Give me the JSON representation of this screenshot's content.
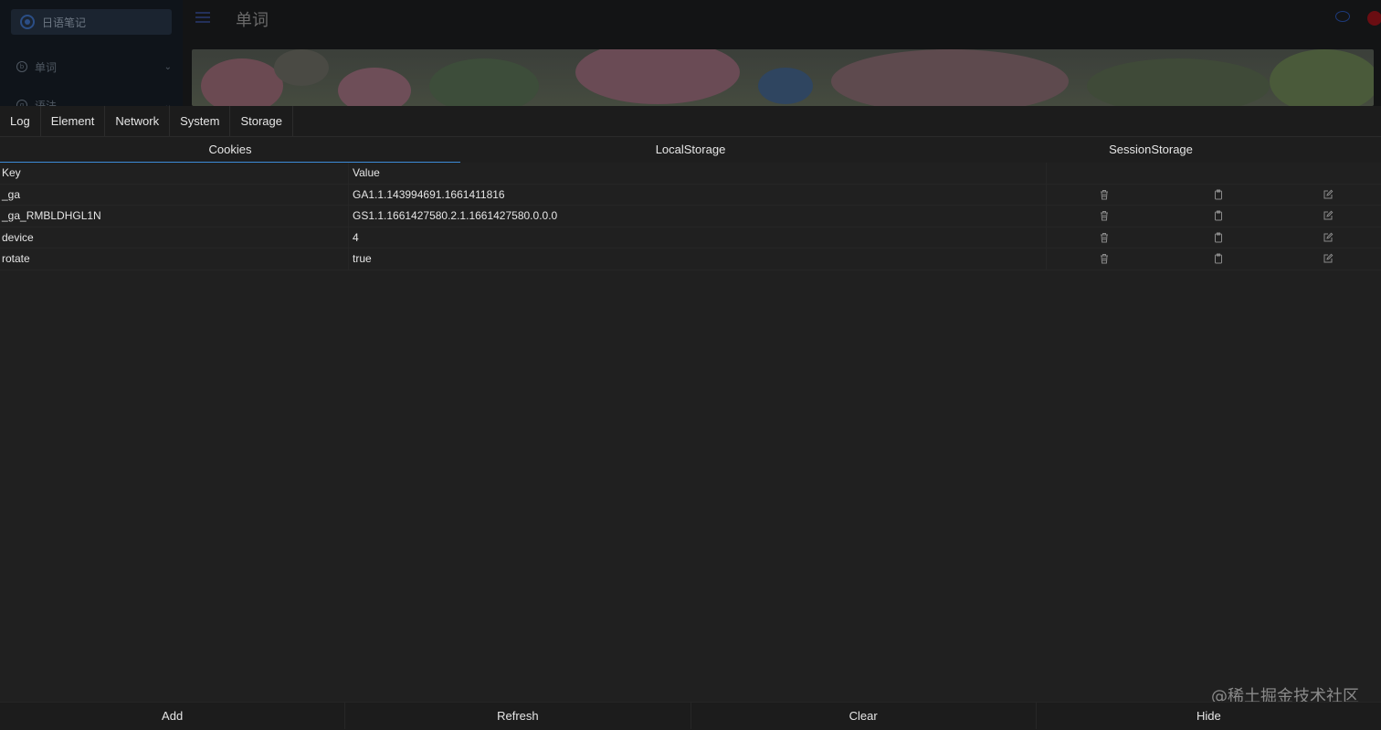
{
  "app": {
    "search_placeholder": "日语笔记",
    "nav": [
      {
        "label": "单词"
      },
      {
        "label": "语法"
      }
    ],
    "page_title": "单词"
  },
  "console": {
    "tabs": [
      {
        "label": "Log"
      },
      {
        "label": "Element"
      },
      {
        "label": "Network"
      },
      {
        "label": "System"
      },
      {
        "label": "Storage"
      }
    ],
    "storage_tabs": [
      {
        "label": "Cookies",
        "active": true
      },
      {
        "label": "LocalStorage",
        "active": false
      },
      {
        "label": "SessionStorage",
        "active": false
      }
    ],
    "columns": {
      "key": "Key",
      "value": "Value"
    },
    "rows": [
      {
        "key": "_ga",
        "value": "GA1.1.143994691.1661411816"
      },
      {
        "key": "_ga_RMBLDHGL1N",
        "value": "GS1.1.1661427580.2.1.1661427580.0.0.0"
      },
      {
        "key": "device",
        "value": "4"
      },
      {
        "key": "rotate",
        "value": "true"
      }
    ],
    "row_actions": [
      "trash-icon",
      "clipboard-icon",
      "edit-icon"
    ],
    "bottom_buttons": [
      {
        "label": "Add"
      },
      {
        "label": "Refresh"
      },
      {
        "label": "Clear"
      },
      {
        "label": "Hide"
      }
    ]
  },
  "watermark": "@稀土掘金技术社区",
  "colors": {
    "panel_bg": "#202020",
    "active_tab_underline": "#3c8bd9",
    "text": "#e6e6e6"
  }
}
